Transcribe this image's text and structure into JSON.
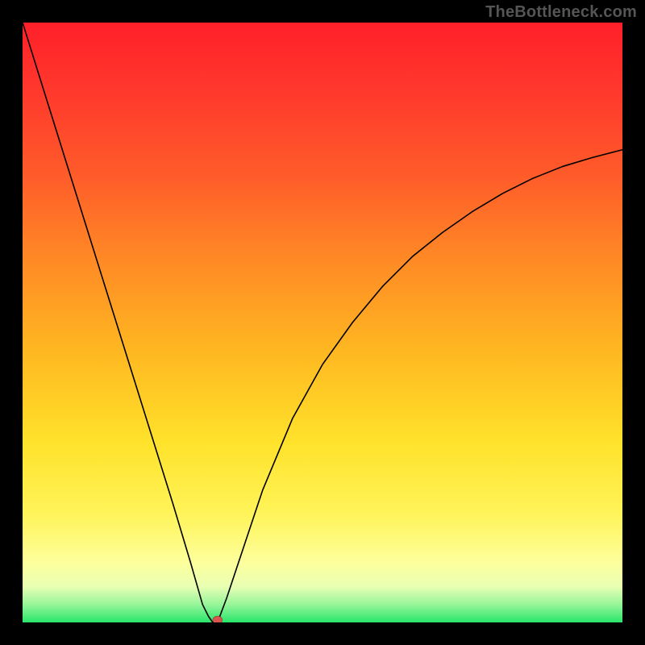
{
  "watermark": "TheBottleneck.com",
  "chart_data": {
    "type": "line",
    "title": "",
    "xlabel": "",
    "ylabel": "",
    "xlim": [
      0,
      100
    ],
    "ylim": [
      0,
      100
    ],
    "background_gradient": {
      "top": "#ff1f2a",
      "mid": "#ffe22a",
      "bottom": "#29e56a"
    },
    "series": [
      {
        "name": "bottleneck-curve",
        "color": "#000000",
        "x": [
          0,
          5,
          10,
          15,
          20,
          25,
          28,
          30,
          31,
          31.7,
          32.5,
          34,
          36,
          40,
          45,
          50,
          55,
          60,
          65,
          70,
          75,
          80,
          85,
          90,
          95,
          100
        ],
        "y": [
          100,
          84,
          68,
          52,
          36,
          20,
          10,
          3,
          1,
          0,
          0,
          4,
          10,
          22,
          34,
          43,
          50,
          56,
          61,
          65,
          68.5,
          71.5,
          74,
          76,
          77.5,
          78.8
        ]
      }
    ],
    "marker": {
      "name": "optimal-point",
      "x": 32.5,
      "y": 0,
      "color": "#d9534f"
    }
  }
}
